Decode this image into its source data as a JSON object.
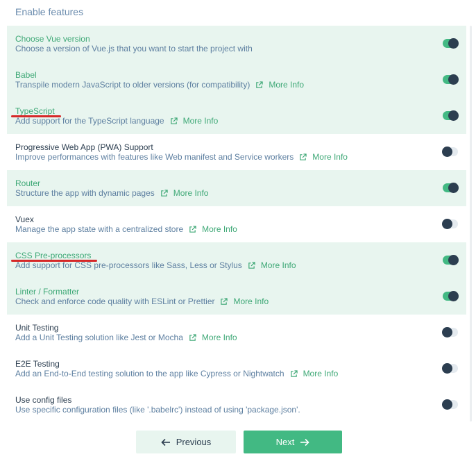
{
  "header": {
    "title": "Enable features"
  },
  "features": [
    {
      "title": "Choose Vue version",
      "description": "Choose a version of Vue.js that you want to start the project with",
      "more_info": "",
      "enabled": true
    },
    {
      "title": "Babel",
      "description": "Transpile modern JavaScript to older versions (for compatibility)",
      "more_info": "More Info",
      "enabled": true
    },
    {
      "title": "TypeScript",
      "description": "Add support for the TypeScript language",
      "more_info": "More Info",
      "enabled": true
    },
    {
      "title": "Progressive Web App (PWA) Support",
      "description": "Improve performances with features like Web manifest and Service workers",
      "more_info": "More Info",
      "enabled": false
    },
    {
      "title": "Router",
      "description": "Structure the app with dynamic pages",
      "more_info": "More Info",
      "enabled": true
    },
    {
      "title": "Vuex",
      "description": "Manage the app state with a centralized store",
      "more_info": "More Info",
      "enabled": false
    },
    {
      "title": "CSS Pre-processors",
      "description": "Add support for CSS pre-processors like Sass, Less or Stylus",
      "more_info": "More Info",
      "enabled": true
    },
    {
      "title": "Linter / Formatter",
      "description": "Check and enforce code quality with ESLint or Prettier",
      "more_info": "More Info",
      "enabled": true
    },
    {
      "title": "Unit Testing",
      "description": "Add a Unit Testing solution like Jest or Mocha",
      "more_info": "More Info",
      "enabled": false
    },
    {
      "title": "E2E Testing",
      "description": "Add an End-to-End testing solution to the app like Cypress or Nightwatch",
      "more_info": "More Info",
      "enabled": false
    },
    {
      "title": "Use config files",
      "description": "Use specific configuration files (like '.babelrc') instead of using 'package.json'.",
      "more_info": "",
      "enabled": false
    }
  ],
  "annotations": {
    "underlined_features": [
      "TypeScript",
      "CSS Pre-processors"
    ],
    "underline_color": "#d62828"
  },
  "footer": {
    "previous_label": "Previous",
    "next_label": "Next"
  },
  "colors": {
    "accent": "#42b983",
    "accent_text": "#3ea876",
    "row_enabled_bg": "#e8f5ef",
    "knob": "#2c3e50",
    "description": "#5d7fa0"
  },
  "icons": {
    "more_info": "external-link-icon",
    "previous": "arrow-left-icon",
    "next": "arrow-right-icon"
  }
}
